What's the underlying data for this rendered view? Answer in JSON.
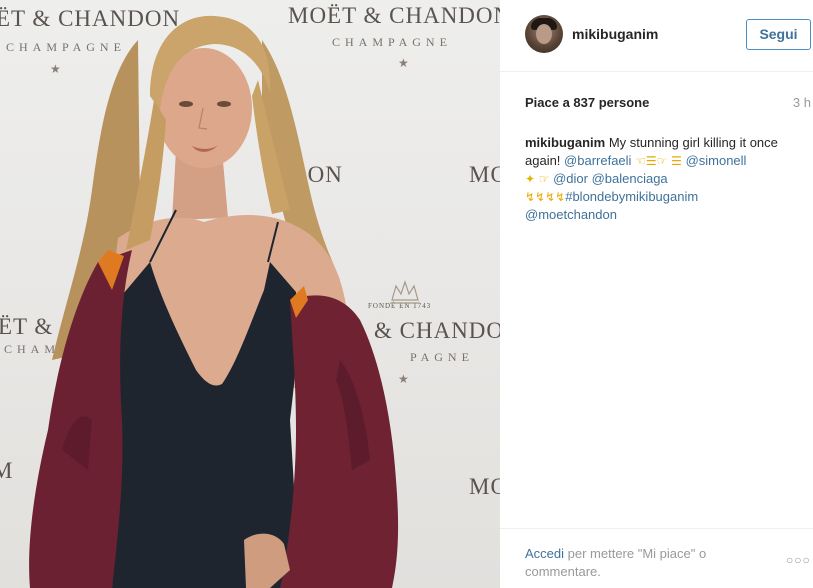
{
  "photo": {
    "brand_left": "ËT & CHANDON",
    "brand_left_sub": "CHAMPAGNE",
    "brand_top": "MOËT & CHANDON",
    "brand_top_sub": "CHAMPAGNE",
    "brand_mid_right": "DON",
    "brand_far_right": "MO",
    "brand_mid_left": "ËT & C",
    "brand_mid_left_sub": "CHAMPA",
    "brand_mid_center": "& CHANDON",
    "brand_mid_center_sub": "PAGNE",
    "brand_fonde": "FONDÉ EN 1743",
    "brand_low_right": "MO",
    "brand_low_left": "M"
  },
  "header": {
    "username": "mikibuganim",
    "follow_label": "Segui"
  },
  "stats": {
    "likes": "Piace a 837 persone",
    "time": "3 h"
  },
  "caption": {
    "user": "mikibuganim",
    "text": "My stunning girl killing it once again!",
    "mentions": [
      "@barrefaeli",
      "@simonell",
      "@dior",
      "@balenciaga",
      "@moetchandon"
    ],
    "hashtag": "#blondebymikibuganim",
    "emojis": {
      "group1": "☜☰☞ ☰",
      "sparkle": "✦",
      "point": "☞",
      "bolts": "↯↯↯↯"
    }
  },
  "footer": {
    "login_link": "Accedi",
    "login_text": " per mettere \"Mi piace\" o commentare.",
    "more": "○○○"
  },
  "colors": {
    "link": "#3f729b",
    "muted": "#999999",
    "text": "#262626",
    "button_border": "#4a90c8",
    "dress": "#1c232b",
    "jacket": "#6d2230",
    "hair": "#c9a46d",
    "skin": "#d9a98e"
  }
}
